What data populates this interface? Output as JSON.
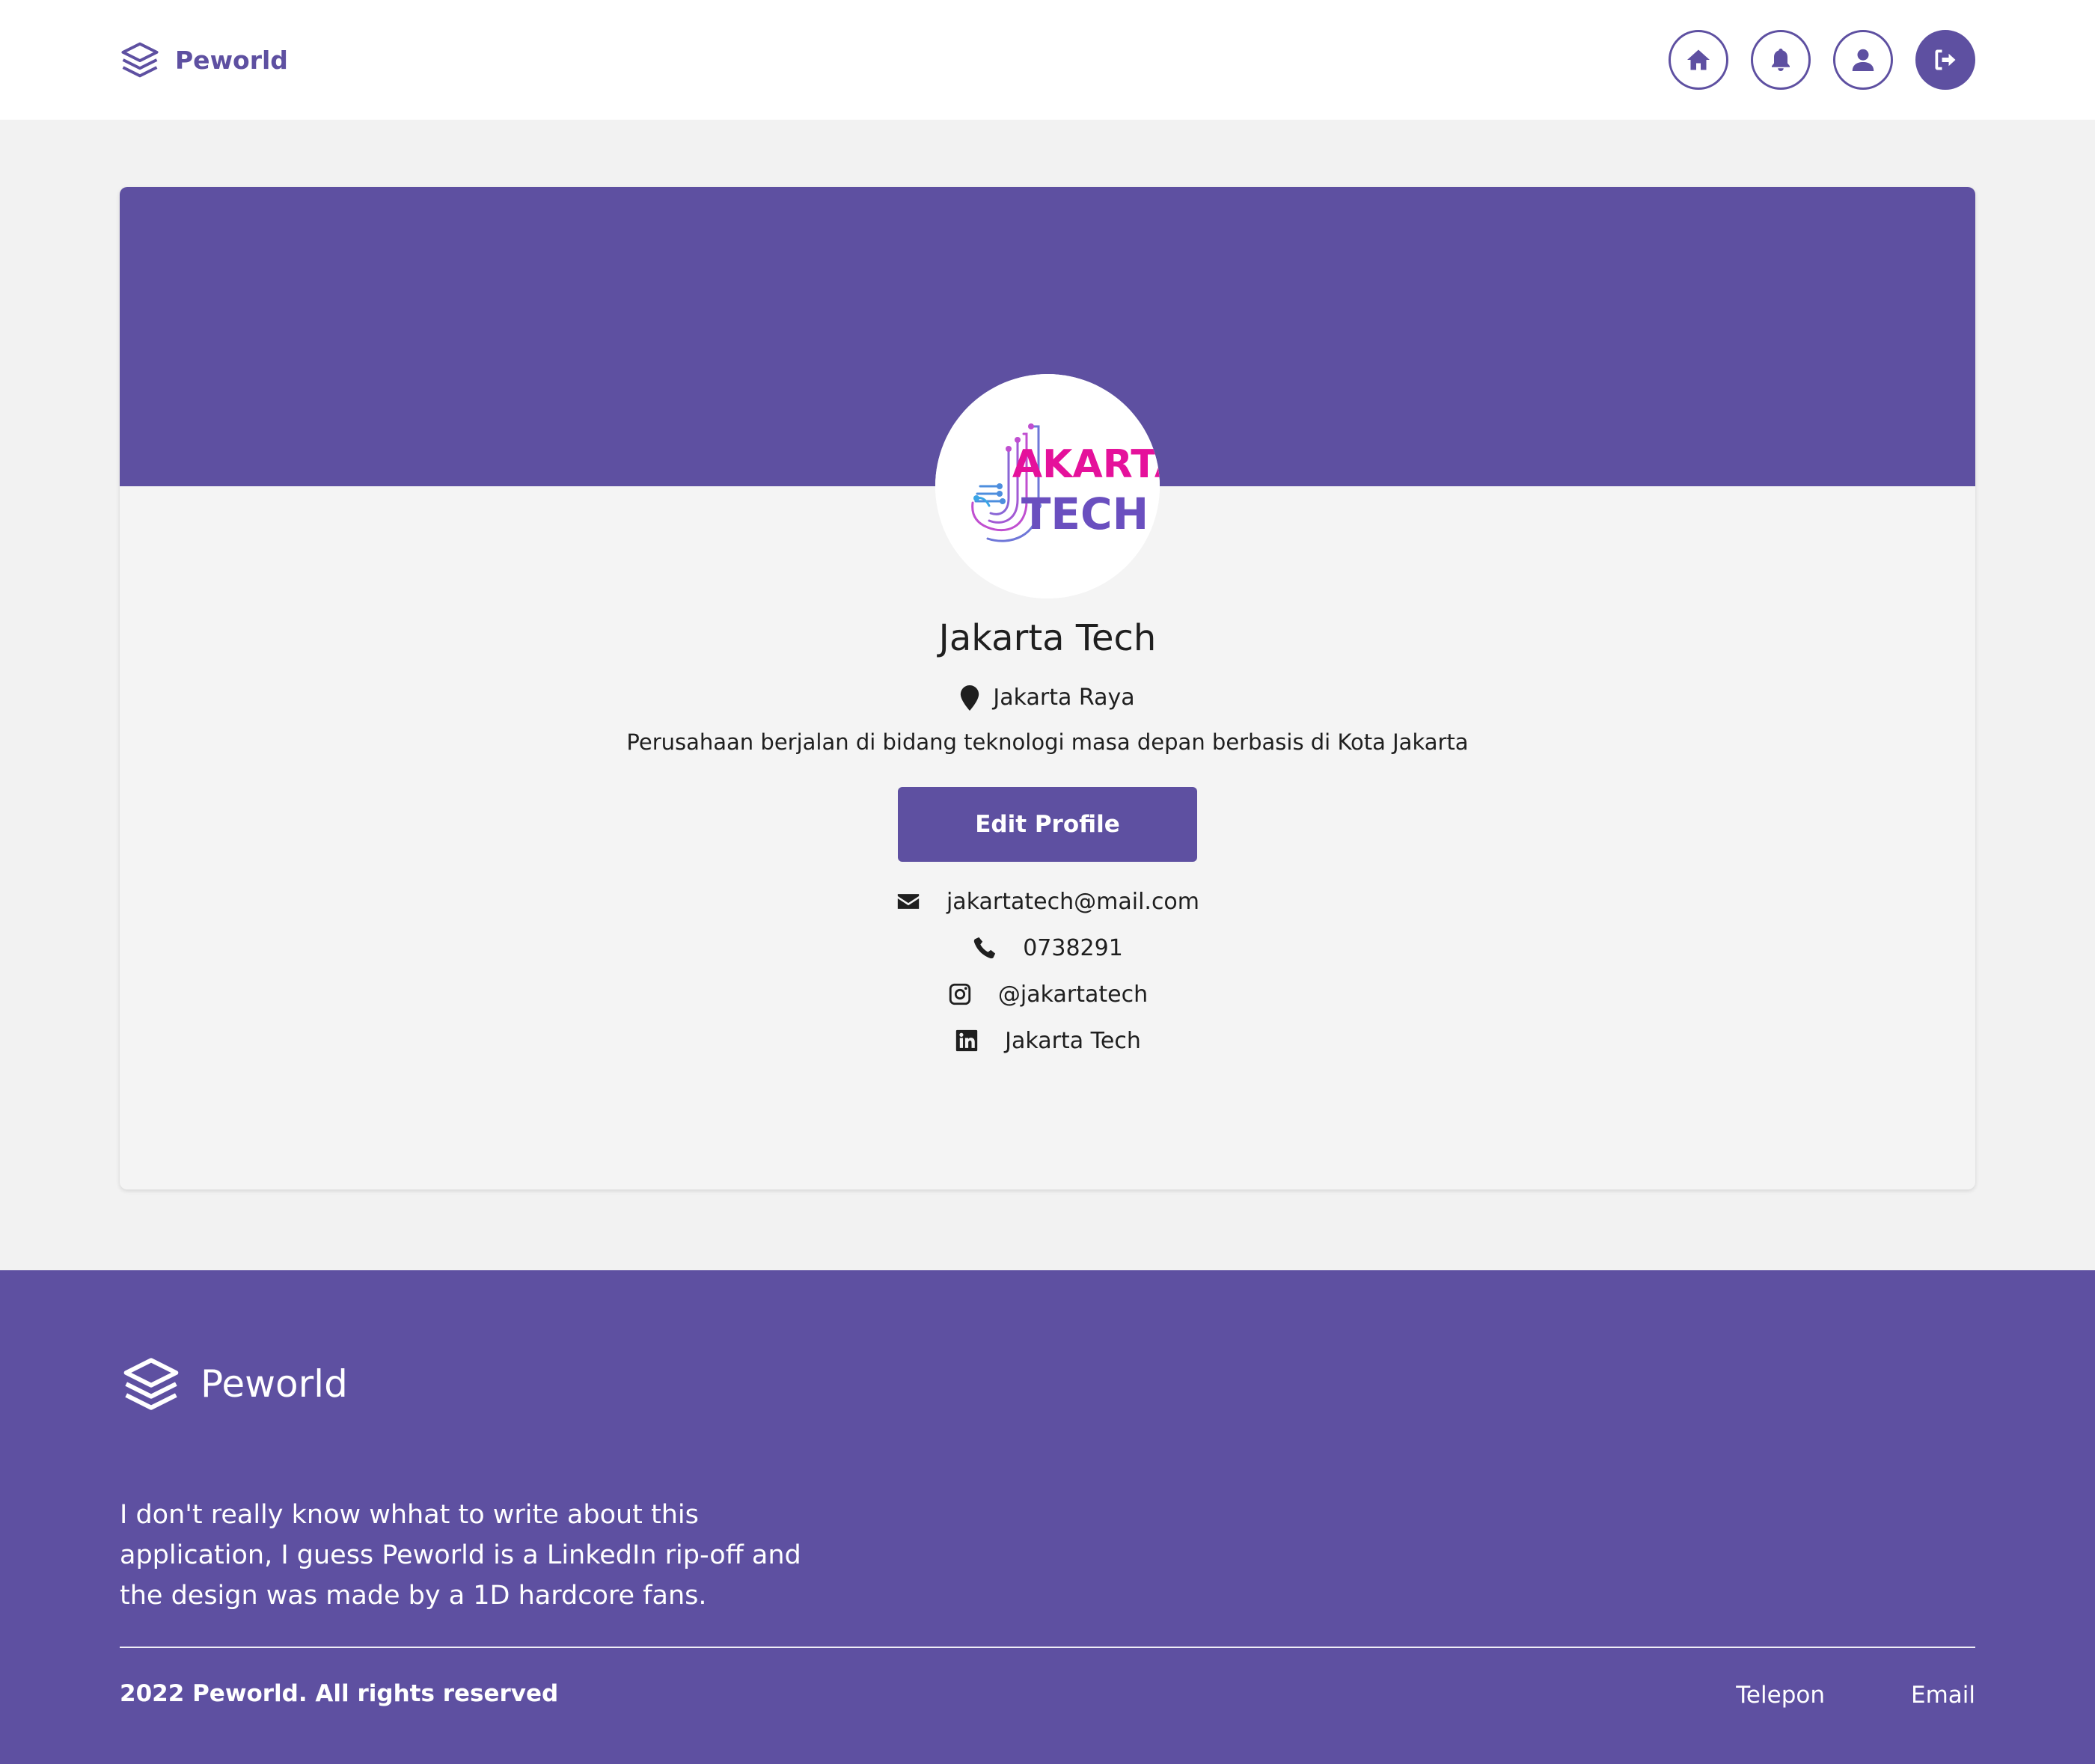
{
  "navbar": {
    "brand": "Peworld",
    "icons": [
      "home-icon",
      "bell-icon",
      "user-icon",
      "logout-icon"
    ]
  },
  "profile": {
    "logo_text_top": "AKARTA",
    "logo_text_bottom": "TECH",
    "name": "Jakarta Tech",
    "location": "Jakarta Raya",
    "description": "Perusahaan berjalan di bidang teknologi masa depan berbasis di Kota Jakarta",
    "edit_button": "Edit Profile",
    "email": "jakartatech@mail.com",
    "phone": "0738291",
    "instagram": "@jakartatech",
    "linkedin": "Jakarta Tech"
  },
  "footer": {
    "brand": "Peworld",
    "about": "I don't really know whhat to write about this application, I guess Peworld is a LinkedIn rip-off and the design was made by a 1D hardcore fans.",
    "copyright": "2022 Peworld. All rights reserved",
    "links": [
      "Telepon",
      "Email"
    ]
  },
  "colors": {
    "primary": "#5e50a1",
    "page_bg": "#f2f2f2",
    "logo_pink": "#e5119b",
    "logo_purple": "#6a4fbf"
  }
}
